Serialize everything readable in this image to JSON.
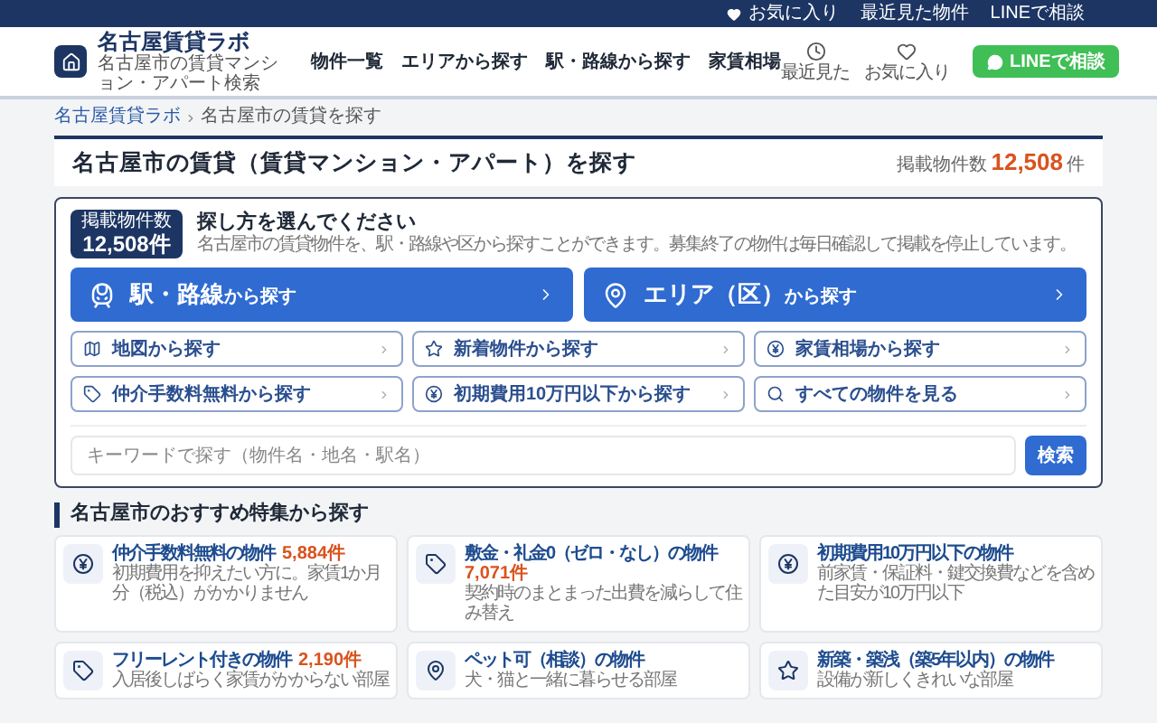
{
  "top_bar": {
    "links": [
      {
        "kind": "heart",
        "label": "お気に入り"
      },
      {
        "kind": "plain",
        "label": "最近見た物件"
      },
      {
        "kind": "plain",
        "label": "LINEで相談"
      }
    ]
  },
  "header": {
    "logo_title": "名古屋賃貸ラボ",
    "logo_subtitle": "名古屋市の賃貸マンション・アパート検索",
    "nav": [
      "物件一覧",
      "エリアから探す",
      "駅・路線から探す",
      "家賃相場"
    ],
    "icon_links": [
      {
        "kind": "clock",
        "label": "最近見た"
      },
      {
        "kind": "heart",
        "label": "お気に入り"
      }
    ],
    "line_button": "LINEで相談"
  },
  "breadcrumb": [
    "名古屋賃貸ラボ",
    "名古屋市の賃貸を探す"
  ],
  "page_title": {
    "title": "名古屋市の賃貸（賃貸マンション・アパート）を探す",
    "count_label": "掲載物件数",
    "count": "12,508",
    "count_unit": "件"
  },
  "search_panel": {
    "badge_label": "掲載物件数",
    "badge_count": "12,508件",
    "heading": "探し方を選んでください",
    "description": "名古屋市の賃貸物件を、駅・路線や区から探すことができます。募集終了の物件は毎日確認して掲載を停止しています。",
    "primary_buttons": [
      {
        "kind": "train",
        "label": "駅・路線",
        "suffix": "から探す"
      },
      {
        "kind": "pin",
        "label": "エリア（区）",
        "suffix": "から探す"
      }
    ],
    "secondary_buttons": [
      {
        "kind": "map",
        "label": "地図から探す"
      },
      {
        "kind": "star",
        "label": "新着物件から探す"
      },
      {
        "kind": "yen",
        "label": "家賃相場から探す"
      },
      {
        "kind": "tag",
        "label": "仲介手数料無料から探す"
      },
      {
        "kind": "yen",
        "label": "初期費用10万円以下から探す"
      },
      {
        "kind": "search",
        "label": "すべての物件を見る"
      }
    ],
    "keyword_placeholder": "キーワードで探す（物件名・地名・駅名）",
    "search_button": "検索"
  },
  "features": {
    "title": "名古屋市のおすすめ特集から探す",
    "cards": [
      {
        "kind": "yen",
        "title": "仲介手数料無料の物件",
        "count": "5,884件",
        "description": "初期費用を抑えたい方に。家賃1か月分（税込）がかかりません"
      },
      {
        "kind": "tag",
        "title": "敷金・礼金0（ゼロ・なし）の物件",
        "count": "7,071件",
        "description": "契約時のまとまった出費を減らして住み替え"
      },
      {
        "kind": "yen",
        "title": "初期費用10万円以下の物件",
        "description": "前家賃・保証料・鍵交換費などを含めた目安が10万円以下"
      },
      {
        "kind": "tag",
        "title": "フリーレント付きの物件",
        "count": "2,190件",
        "description": "入居後しばらく家賃がかからない部屋"
      },
      {
        "kind": "pin",
        "title": "ペット可（相談）の物件",
        "description": "犬・猫と一緒に暮らせる部屋"
      },
      {
        "kind": "star",
        "title": "新築・築浅（築5年以内）の物件",
        "description": "設備が新しくきれいな部屋"
      }
    ]
  }
}
